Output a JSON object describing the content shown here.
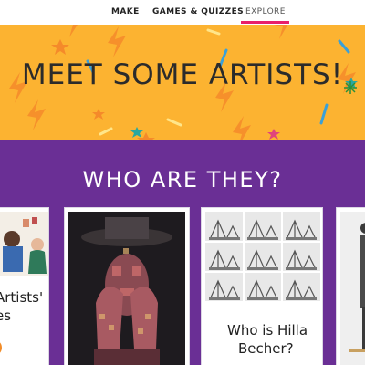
{
  "nav": {
    "items": [
      {
        "label": "MAKE"
      },
      {
        "label": "GAMES & QUIZZES"
      },
      {
        "label": "EXPLORE"
      }
    ],
    "active": "EXPLORE"
  },
  "banner": {
    "title": "MEET SOME ARTISTS!",
    "background_color": "#fcb331"
  },
  "section": {
    "title": "WHO ARE THEY?",
    "background_color": "#6a2f95"
  },
  "cards": [
    {
      "line1": "Artists'",
      "line2": "es",
      "icon": "portrait-illustration"
    },
    {
      "icon": "masked-face-collage"
    },
    {
      "line1": "Who is Hilla",
      "line2": "Becher?",
      "icon": "industrial-tower-photo-grid"
    },
    {
      "icon": "standing-figure-photo"
    }
  ],
  "colors": {
    "accent": "#e81f6b",
    "title_text": "#2b2b2b"
  }
}
